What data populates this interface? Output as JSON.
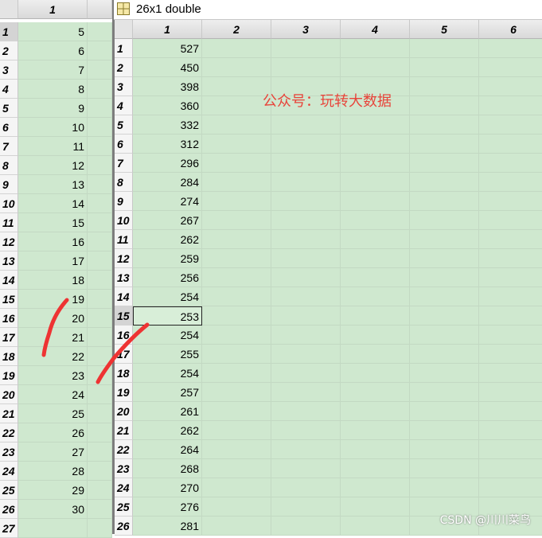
{
  "left_panel": {
    "column_header": "1",
    "rows": [
      {
        "label": "1",
        "value": "5"
      },
      {
        "label": "2",
        "value": "6"
      },
      {
        "label": "3",
        "value": "7"
      },
      {
        "label": "4",
        "value": "8"
      },
      {
        "label": "5",
        "value": "9"
      },
      {
        "label": "6",
        "value": "10"
      },
      {
        "label": "7",
        "value": "11"
      },
      {
        "label": "8",
        "value": "12"
      },
      {
        "label": "9",
        "value": "13"
      },
      {
        "label": "10",
        "value": "14"
      },
      {
        "label": "11",
        "value": "15"
      },
      {
        "label": "12",
        "value": "16"
      },
      {
        "label": "13",
        "value": "17"
      },
      {
        "label": "14",
        "value": "18"
      },
      {
        "label": "15",
        "value": "19"
      },
      {
        "label": "16",
        "value": "20"
      },
      {
        "label": "17",
        "value": "21"
      },
      {
        "label": "18",
        "value": "22"
      },
      {
        "label": "19",
        "value": "23"
      },
      {
        "label": "20",
        "value": "24"
      },
      {
        "label": "21",
        "value": "25"
      },
      {
        "label": "22",
        "value": "26"
      },
      {
        "label": "23",
        "value": "27"
      },
      {
        "label": "24",
        "value": "28"
      },
      {
        "label": "25",
        "value": "29"
      },
      {
        "label": "26",
        "value": "30"
      },
      {
        "label": "27",
        "value": ""
      }
    ],
    "selected_row": "1"
  },
  "right_panel": {
    "title": "26x1 double",
    "icon": "variable-table-icon",
    "column_headers": [
      "1",
      "2",
      "3",
      "4",
      "5",
      "6"
    ],
    "rows": [
      {
        "label": "1",
        "value": "527"
      },
      {
        "label": "2",
        "value": "450"
      },
      {
        "label": "3",
        "value": "398"
      },
      {
        "label": "4",
        "value": "360"
      },
      {
        "label": "5",
        "value": "332"
      },
      {
        "label": "6",
        "value": "312"
      },
      {
        "label": "7",
        "value": "296"
      },
      {
        "label": "8",
        "value": "284"
      },
      {
        "label": "9",
        "value": "274"
      },
      {
        "label": "10",
        "value": "267"
      },
      {
        "label": "11",
        "value": "262"
      },
      {
        "label": "12",
        "value": "259"
      },
      {
        "label": "13",
        "value": "256"
      },
      {
        "label": "14",
        "value": "254"
      },
      {
        "label": "15",
        "value": "253"
      },
      {
        "label": "16",
        "value": "254"
      },
      {
        "label": "17",
        "value": "255"
      },
      {
        "label": "18",
        "value": "254"
      },
      {
        "label": "19",
        "value": "257"
      },
      {
        "label": "20",
        "value": "261"
      },
      {
        "label": "21",
        "value": "262"
      },
      {
        "label": "22",
        "value": "264"
      },
      {
        "label": "23",
        "value": "268"
      },
      {
        "label": "24",
        "value": "270"
      },
      {
        "label": "25",
        "value": "276"
      },
      {
        "label": "26",
        "value": "281"
      }
    ],
    "selected_row": "15"
  },
  "annotation_text": "公众号：玩转大数据",
  "watermark": "CSDN @川川菜鸟",
  "colors": {
    "cell_bg": "#cfe8cf",
    "annotation": "#e8443a",
    "pen_stroke": "#ee3333"
  }
}
